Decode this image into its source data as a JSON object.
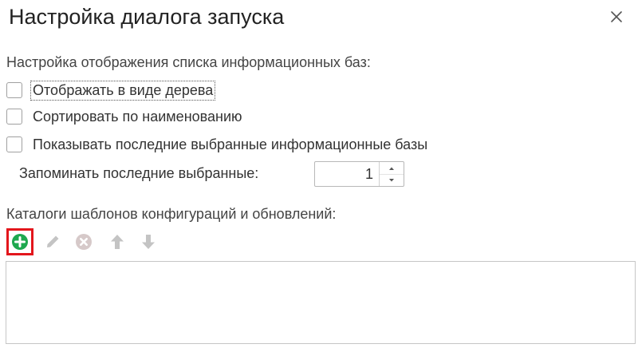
{
  "dialog": {
    "title": "Настройка диалога запуска",
    "close_icon": "close-icon"
  },
  "display_section": {
    "label": "Настройка отображения списка информационных баз:",
    "options": [
      {
        "label": "Отображать в виде дерева",
        "checked": false
      },
      {
        "label": "Сортировать по наименованию",
        "checked": false
      },
      {
        "label": "Показывать последние выбранные информационные базы",
        "checked": false
      }
    ],
    "remember_label": "Запоминать последние выбранные:",
    "remember_value": "1"
  },
  "templates_section": {
    "label": "Каталоги шаблонов конфигураций и обновлений:",
    "toolbar": [
      {
        "name": "add",
        "icon": "plus-circle-icon",
        "enabled": true,
        "color": "#1ea84f"
      },
      {
        "name": "edit",
        "icon": "pencil-icon",
        "enabled": false
      },
      {
        "name": "delete",
        "icon": "x-circle-icon",
        "enabled": false
      },
      {
        "name": "move-up",
        "icon": "arrow-up-icon",
        "enabled": false
      },
      {
        "name": "move-down",
        "icon": "arrow-down-icon",
        "enabled": false
      }
    ],
    "items": []
  },
  "colors": {
    "highlight": "#e3161c",
    "add_green": "#1ea84f",
    "disabled_icon": "#c4c4c4"
  }
}
